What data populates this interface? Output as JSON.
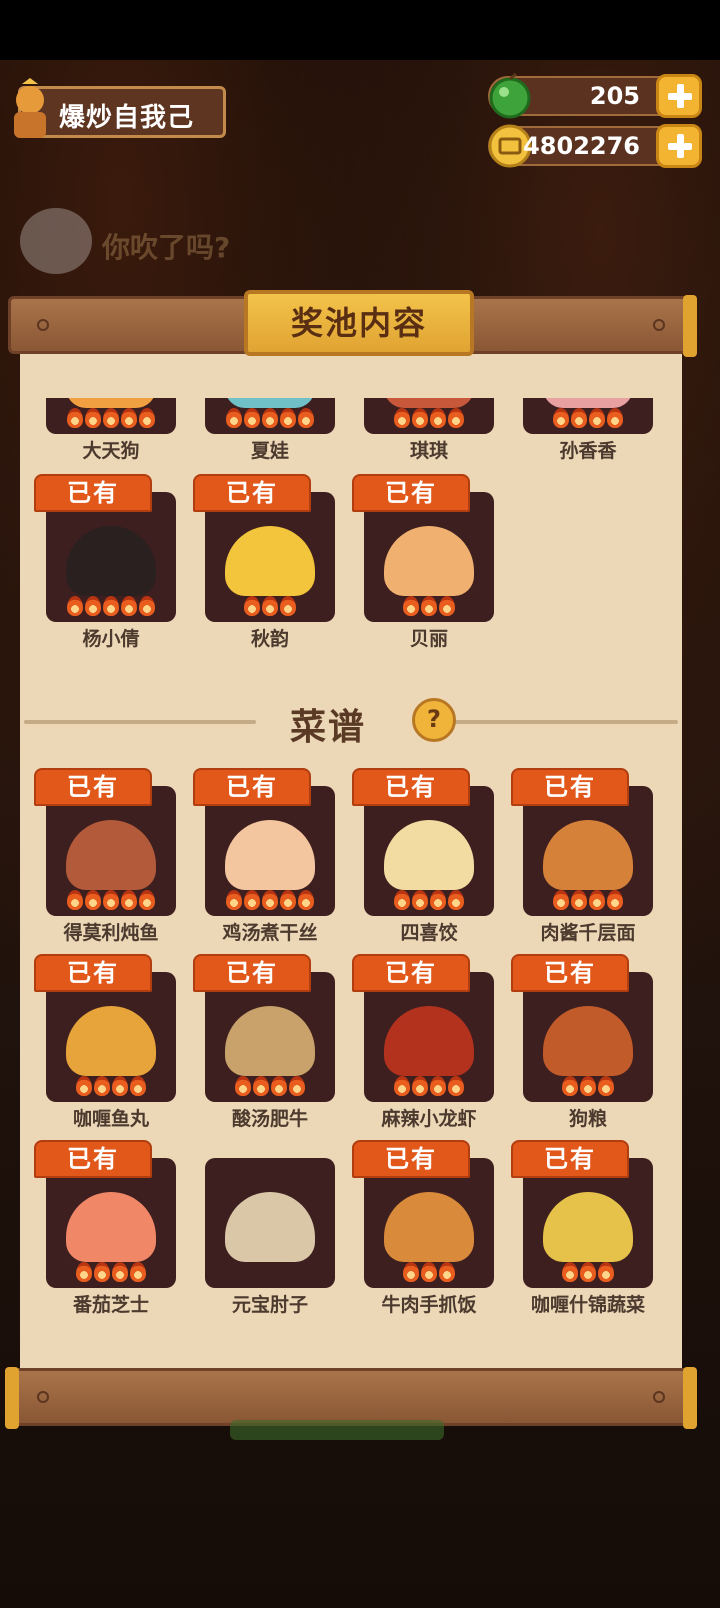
{
  "player": {
    "name": "爆炒自我己"
  },
  "currency": {
    "gems": "205",
    "coins": "4802276"
  },
  "chat_hint": "你吹了吗?",
  "panel": {
    "title": "奖池内容"
  },
  "characters_partial": [
    {
      "name": "大天狗",
      "stars": 5,
      "color": "#f0a040"
    },
    {
      "name": "夏娃",
      "stars": 5,
      "color": "#70c0c8"
    },
    {
      "name": "琪琪",
      "stars": 4,
      "color": "#c8583a"
    },
    {
      "name": "孙香香",
      "stars": 4,
      "color": "#e8a0a0"
    }
  ],
  "characters": [
    {
      "name": "杨小倩",
      "owned": "已有",
      "stars": 5,
      "color": "#2a2020"
    },
    {
      "name": "秋韵",
      "owned": "已有",
      "stars": 3,
      "color": "#f2c53c"
    },
    {
      "name": "贝丽",
      "owned": "已有",
      "stars": 3,
      "color": "#f0b070"
    }
  ],
  "recipe_section": {
    "title": "菜谱",
    "help": "?"
  },
  "recipes": [
    {
      "name": "得莫利炖鱼",
      "owned": "已有",
      "stars": 5,
      "color": "#b25a3a"
    },
    {
      "name": "鸡汤煮干丝",
      "owned": "已有",
      "stars": 5,
      "color": "#f3c6a0"
    },
    {
      "name": "四喜饺",
      "owned": "已有",
      "stars": 4,
      "color": "#f2dca2"
    },
    {
      "name": "肉酱千层面",
      "owned": "已有",
      "stars": 4,
      "color": "#d6813a"
    },
    {
      "name": "咖喱鱼丸",
      "owned": "已有",
      "stars": 4,
      "color": "#e7a43a"
    },
    {
      "name": "酸汤肥牛",
      "owned": "已有",
      "stars": 4,
      "color": "#c8a26a"
    },
    {
      "name": "麻辣小龙虾",
      "owned": "已有",
      "stars": 4,
      "color": "#b2321e"
    },
    {
      "name": "狗粮",
      "owned": "已有",
      "stars": 3,
      "color": "#c25b2a"
    },
    {
      "name": "番茄芝士",
      "owned": "已有",
      "stars": 4,
      "color": "#f08868"
    },
    {
      "name": "元宝肘子",
      "owned": "",
      "stars": 0,
      "color": "#d9c7a8"
    },
    {
      "name": "牛肉手抓饭",
      "owned": "已有",
      "stars": 3,
      "color": "#d98a3a"
    },
    {
      "name": "咖喱什锦蔬菜",
      "owned": "已有",
      "stars": 3,
      "color": "#e6c24a"
    }
  ]
}
